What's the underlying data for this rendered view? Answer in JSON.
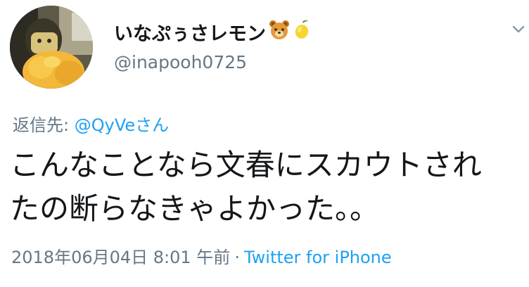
{
  "user": {
    "display_name": "いなぷぅさレモン",
    "handle": "@inapooh0725",
    "name_emojis": [
      "bear-face-icon",
      "lemon-icon"
    ]
  },
  "reply": {
    "label": "返信先:",
    "mention": "@QyVeさん"
  },
  "tweet": {
    "lines": [
      "こんなことなら文春にスカウトされ",
      "たの断らなきゃよかった。。"
    ]
  },
  "meta": {
    "timestamp": "2018年06月04日 8:01 午前",
    "separator": "·",
    "source": "Twitter for iPhone"
  },
  "colors": {
    "text": "#14171a",
    "secondary": "#657786",
    "link": "#1da1f2"
  }
}
